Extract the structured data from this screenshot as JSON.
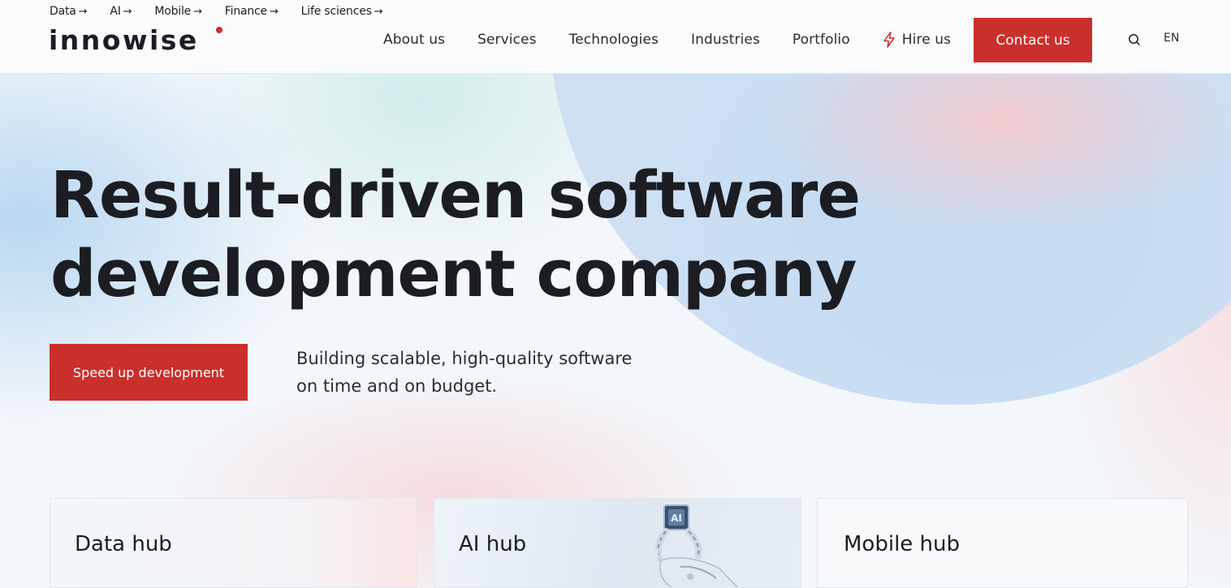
{
  "header": {
    "quick_links": [
      {
        "label": "Data",
        "arrow": "→"
      },
      {
        "label": "AI",
        "arrow": "→"
      },
      {
        "label": "Mobile",
        "arrow": "→"
      },
      {
        "label": "Finance",
        "arrow": "→"
      },
      {
        "label": "Life sciences",
        "arrow": "→"
      }
    ],
    "logo": "innowise",
    "nav": {
      "about": "About us",
      "services": "Services",
      "technologies": "Technologies",
      "industries": "Industries",
      "portfolio": "Portfolio",
      "hire": "Hire us"
    },
    "contact_label": "Contact us",
    "language": "EN"
  },
  "hero": {
    "title_line1": "Result-driven software",
    "title_line2": "development company",
    "cta_label": "Speed up development",
    "subtitle_line1": "Building scalable, high-quality software",
    "subtitle_line2": "on time and on budget."
  },
  "hubs": [
    {
      "title": "Data hub"
    },
    {
      "title": "AI hub",
      "chip_text": "AI"
    },
    {
      "title": "Mobile hub"
    }
  ],
  "colors": {
    "accent": "#c9302c",
    "text": "#1b1d22"
  },
  "icons": {
    "hire": "lightning-icon",
    "search": "search-icon",
    "arrow": "arrow-right-icon"
  }
}
